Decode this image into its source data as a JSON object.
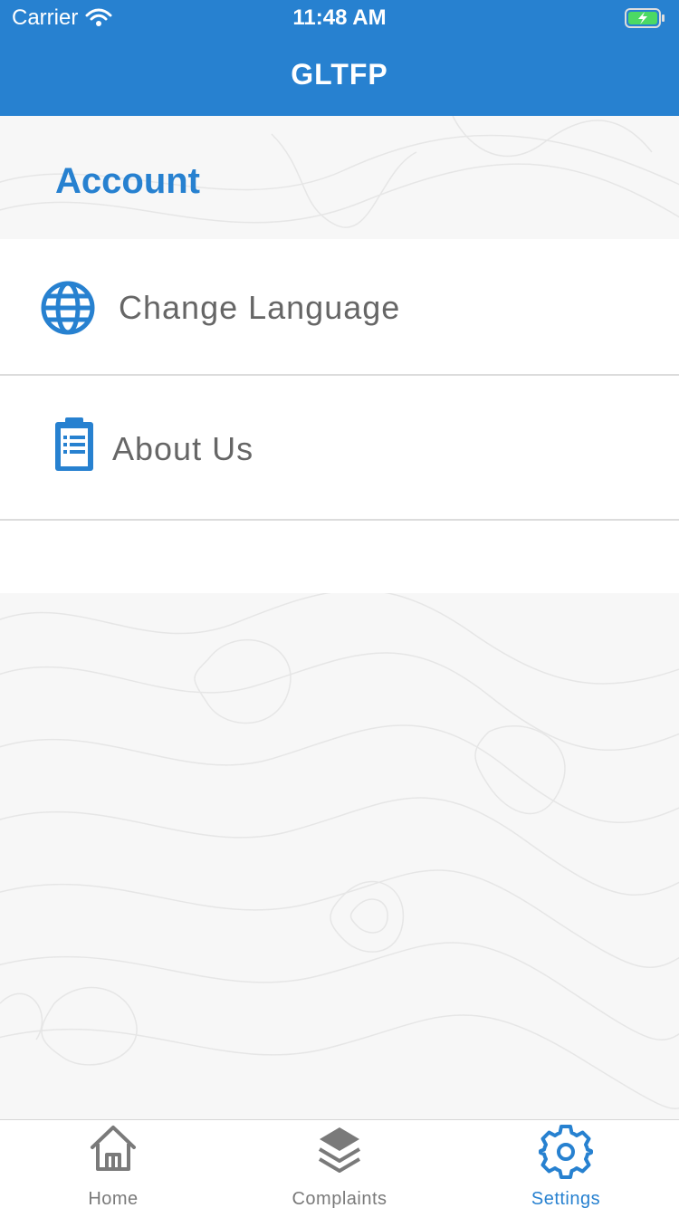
{
  "status_bar": {
    "carrier": "Carrier",
    "time": "11:48 AM"
  },
  "nav": {
    "title": "GLTFP"
  },
  "section": {
    "title": "Account"
  },
  "settings_items": [
    {
      "label": "Change Language",
      "icon": "globe-icon"
    },
    {
      "label": "About Us",
      "icon": "clipboard-icon"
    }
  ],
  "tabs": [
    {
      "label": "Home",
      "icon": "home-icon"
    },
    {
      "label": "Complaints",
      "icon": "layers-icon"
    },
    {
      "label": "Settings",
      "icon": "gear-icon",
      "active": true
    }
  ],
  "colors": {
    "accent": "#2781d0",
    "tab_inactive": "#7a7a7a",
    "battery_green": "#4cd964"
  }
}
